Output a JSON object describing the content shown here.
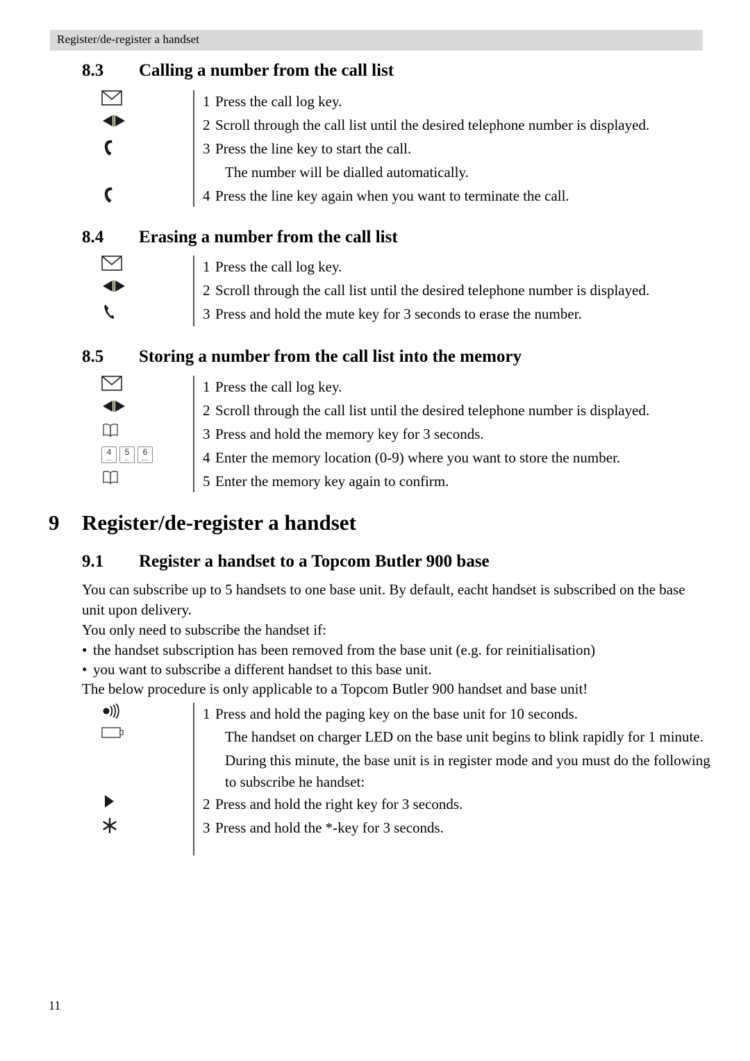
{
  "header": {
    "running_title": "Register/de-register a handset"
  },
  "footer": {
    "page_number": "11"
  },
  "sections": {
    "s83": {
      "number": "8.3",
      "title": "Calling a number from the call list",
      "steps": [
        {
          "icon": "envelope-icon",
          "num": "1",
          "text": "Press the call log key."
        },
        {
          "icon": "left-right-arrows-icon",
          "num": "2",
          "text": "Scroll through the call list until the desired telephone number is displayed."
        },
        {
          "icon": "phone-handset-icon",
          "num": "3",
          "text": "Press the line key to start the call."
        },
        {
          "icon": "none",
          "num": "",
          "text": "The number will be dialled automatically."
        },
        {
          "icon": "phone-handset-icon",
          "num": "4",
          "text": "Press the line key again when you want to terminate the call."
        }
      ]
    },
    "s84": {
      "number": "8.4",
      "title": "Erasing a number from the call list",
      "steps": [
        {
          "icon": "envelope-icon",
          "num": "1",
          "text": "Press the call log key."
        },
        {
          "icon": "left-right-arrows-icon",
          "num": "2",
          "text": "Scroll through the call list until the desired telephone number is displayed."
        },
        {
          "icon": "mute-handset-icon",
          "num": "3",
          "text": "Press and hold the mute key for 3 seconds to erase the number."
        }
      ]
    },
    "s85": {
      "number": "8.5",
      "title": "Storing a number from the call list into the memory",
      "steps": [
        {
          "icon": "envelope-icon",
          "num": "1",
          "text": "Press the call log key."
        },
        {
          "icon": "left-right-arrows-icon",
          "num": "2",
          "text": "Scroll through the call list until the desired telephone number is displayed."
        },
        {
          "icon": "open-book-icon",
          "num": "3",
          "text": "Press and hold the memory key for 3 seconds."
        },
        {
          "icon": "keypad-icon",
          "num": "4",
          "text": "Enter the memory location (0-9) where you want to store the number."
        },
        {
          "icon": "open-book-icon",
          "num": "5",
          "text": "Enter the memory key again to confirm."
        }
      ]
    },
    "chapter9": {
      "number": "9",
      "title": "Register/de-register a handset"
    },
    "s91": {
      "number": "9.1",
      "title": "Register a handset to a Topcom Butler 900 base",
      "paragraph1": "You can subscribe up to 5 handsets to one base unit. By default, eacht handset is subscribed on the base unit upon delivery.",
      "paragraph2": "You only need to subscribe the handset if:",
      "bullets": [
        "the handset subscription has been removed from the base unit (e.g. for reinitialisation)",
        "you want to subscribe a different handset to this base unit."
      ],
      "paragraph3": "The below procedure is only applicable to a Topcom Butler 900 handset and base unit!",
      "steps": [
        {
          "icon": "paging-speaker-icon",
          "num": "1",
          "text": "Press and hold the paging key on the base unit for 10 seconds."
        },
        {
          "icon": "battery-icon",
          "num": "",
          "text": "The handset on charger LED on the base unit begins to blink rapidly for 1 minute."
        },
        {
          "icon": "none",
          "num": "",
          "text": "During this minute, the base unit is in register mode and you must do the following to subscribe he handset:"
        },
        {
          "icon": "right-arrow-icon",
          "num": "2",
          "text": "Press and hold the right key for 3 seconds."
        },
        {
          "icon": "asterisk-icon",
          "num": "3",
          "text": "Press and hold the *-key for 3 seconds."
        }
      ]
    }
  },
  "keypad": {
    "keys": [
      {
        "digit": "4",
        "letters": "GHI"
      },
      {
        "digit": "5",
        "letters": "JKL"
      },
      {
        "digit": "6",
        "letters": "MNO"
      }
    ]
  },
  "colors": {
    "header_bar": "#d9d9d9",
    "rule": "#545454",
    "text": "#000000"
  },
  "bullet_glyph": "•"
}
